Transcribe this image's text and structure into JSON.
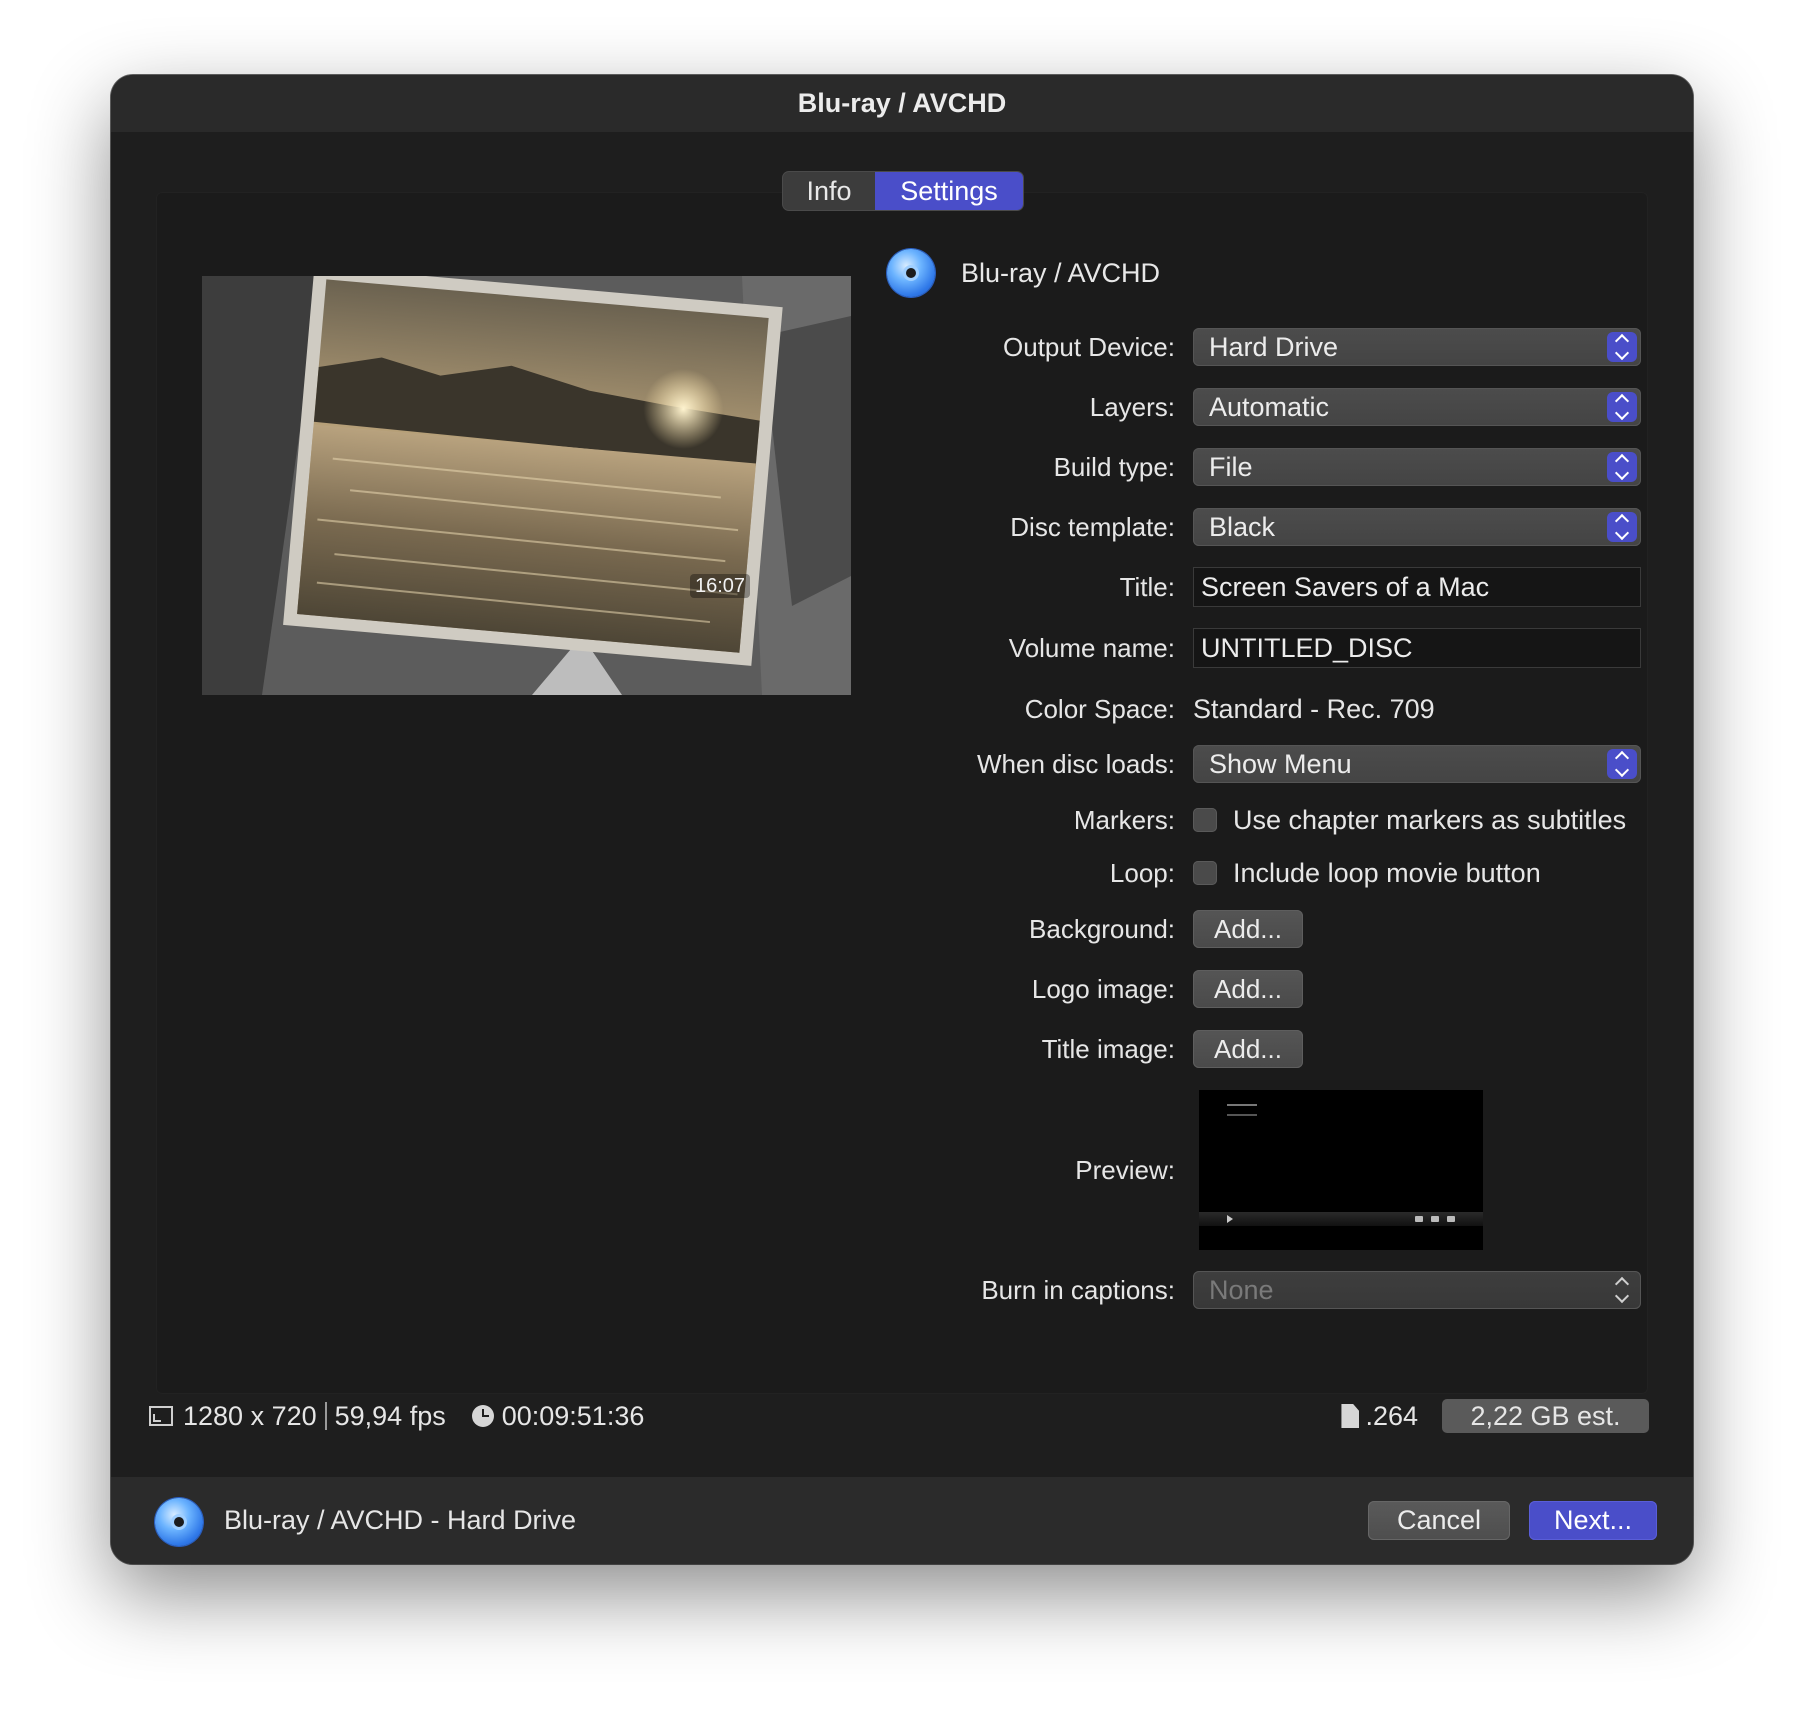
{
  "window": {
    "title": "Blu-ray / AVCHD"
  },
  "tabs": [
    {
      "label": "Info",
      "selected": false
    },
    {
      "label": "Settings",
      "selected": true
    }
  ],
  "thumbnail": {
    "timestamp": "16:07"
  },
  "header": {
    "title": "Blu-ray / AVCHD",
    "icon": "disc-icon"
  },
  "form": {
    "output_device": {
      "label": "Output Device:",
      "value": "Hard Drive"
    },
    "layers": {
      "label": "Layers:",
      "value": "Automatic"
    },
    "build_type": {
      "label": "Build type:",
      "value": "File"
    },
    "disc_template": {
      "label": "Disc template:",
      "value": "Black"
    },
    "title": {
      "label": "Title:",
      "value": "Screen Savers of a Mac"
    },
    "volume_name": {
      "label": "Volume name:",
      "value": "UNTITLED_DISC"
    },
    "color_space": {
      "label": "Color Space:",
      "value": "Standard - Rec. 709"
    },
    "when_disc_loads": {
      "label": "When disc loads:",
      "value": "Show Menu"
    },
    "markers": {
      "label": "Markers:",
      "checkbox_label": "Use chapter markers as subtitles",
      "checked": false
    },
    "loop": {
      "label": "Loop:",
      "checkbox_label": "Include loop movie button",
      "checked": false
    },
    "background": {
      "label": "Background:",
      "button": "Add..."
    },
    "logo_image": {
      "label": "Logo image:",
      "button": "Add..."
    },
    "title_image": {
      "label": "Title image:",
      "button": "Add..."
    },
    "preview": {
      "label": "Preview:"
    },
    "burn_in_captions": {
      "label": "Burn in captions:",
      "value": "None",
      "disabled": true
    }
  },
  "info_bar": {
    "resolution": "1280 x 720",
    "fps": "59,94 fps",
    "duration": "00:09:51:36",
    "format": ".264",
    "size_estimate": "2,22 GB est."
  },
  "footer": {
    "summary": "Blu-ray / AVCHD - Hard Drive",
    "cancel_label": "Cancel",
    "next_label": "Next..."
  },
  "colors": {
    "accent": "#4a4ec9",
    "window_bg": "#1e1e1e",
    "panel_bg": "#1b1b1b",
    "footer_bg": "#2b2b2b"
  }
}
